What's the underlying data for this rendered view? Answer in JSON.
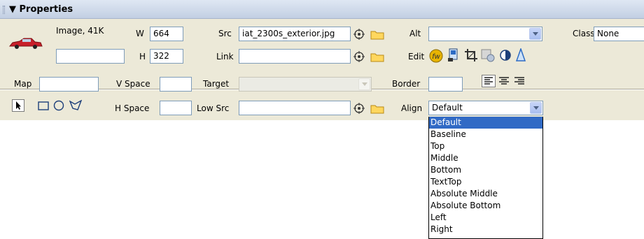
{
  "panel": {
    "title": "▼ Properties"
  },
  "image": {
    "info": "Image, 41K",
    "name_value": "",
    "w_label": "W",
    "w_value": "664",
    "h_label": "H",
    "h_value": "322"
  },
  "src": {
    "label": "Src",
    "value": "iat_2300s_exterior.jpg"
  },
  "link": {
    "label": "Link",
    "value": ""
  },
  "alt": {
    "label": "Alt",
    "value": ""
  },
  "edit": {
    "label": "Edit"
  },
  "class": {
    "label": "Class",
    "value": "None"
  },
  "map": {
    "label": "Map",
    "value": ""
  },
  "vspace": {
    "label": "V Space",
    "value": ""
  },
  "hspace": {
    "label": "H Space",
    "value": ""
  },
  "target": {
    "label": "Target",
    "value": ""
  },
  "lowsrc": {
    "label": "Low Src",
    "value": ""
  },
  "border": {
    "label": "Border",
    "value": ""
  },
  "align": {
    "label": "Align",
    "value": "Default",
    "options": [
      "Default",
      "Baseline",
      "Top",
      "Middle",
      "Bottom",
      "TextTop",
      "Absolute Middle",
      "Absolute Bottom",
      "Left",
      "Right"
    ],
    "selected_index": 0
  },
  "colors": {
    "accent": "#316ac5",
    "panel_bg": "#ece9d8",
    "titlebar": "#c2cfe3"
  },
  "icons": [
    "point-to-file-icon",
    "folder-icon",
    "edit-fireworks-icon",
    "optimize-icon",
    "crop-icon",
    "resample-icon",
    "brightness-contrast-icon",
    "sharpen-icon",
    "pointer-hotspot-icon",
    "rectangle-hotspot-icon",
    "oval-hotspot-icon",
    "polygon-hotspot-icon",
    "align-left-icon",
    "align-center-icon",
    "align-right-icon"
  ]
}
